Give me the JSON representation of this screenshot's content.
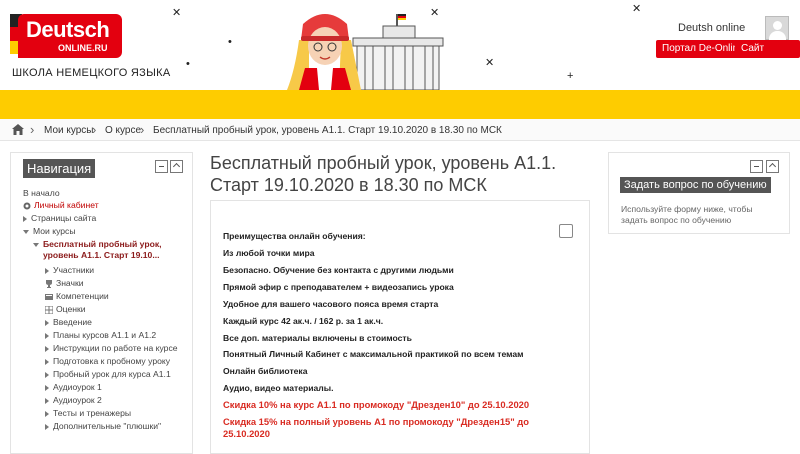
{
  "header": {
    "logo_main": "Deutsch",
    "logo_sub": "ONLINE.RU",
    "school": "ШКОЛА НЕМЕЦКОГО ЯЗЫКА",
    "user_name": "Deutsh online",
    "portal_button": "Портал De-Online",
    "site_button": "Сайт школы",
    "brand_red": "#e3000f",
    "band_yellow": "#fecc00"
  },
  "breadcrumb": {
    "items": [
      "Мои курсы",
      "О курсе",
      "Бесплатный пробный урок, уровень А1.1. Старт 19.10.2020 в 18.30 по МСК"
    ]
  },
  "navigation": {
    "title": "Навигация",
    "home": "В начало",
    "dashboard": "Личный кабинет",
    "site_pages": "Страницы сайта",
    "my_courses": "Мои курсы",
    "current_course": "Бесплатный пробный урок, уровень А1.1. Старт 19.10...",
    "items": [
      "Участники",
      "Значки",
      "Компетенции",
      "Оценки",
      "Введение",
      "Планы курсов А1.1 и А1.2",
      "Инструкции по работе на курсе",
      "Подготовка к пробному уроку",
      "Пробный урок для курса А1.1",
      "Аудиоурок 1",
      "Аудиоурок 2",
      "Тесты и тренажеры",
      "Дополнительные \"плюшки\""
    ]
  },
  "main": {
    "title": "Бесплатный пробный урок, уровень А1.1. Старт 19.10.2020 в 18.30 по МСК",
    "features": [
      "Преимущества онлайн обучения:",
      "Из любой точки мира",
      "Безопасно. Обучение без контакта с другими людьми",
      "Прямой эфир с преподавателем + видеозапись урока",
      "Удобное для вашего часового пояса время старта",
      "Каждый курс 42 ак.ч. / 162 р. за 1 ак.ч.",
      "Все доп. материалы включены в стоимость",
      "Понятный Личный Кабинет с максимальной практикой по всем темам",
      "Онлайн библиотека",
      "Аудио, видео материалы."
    ],
    "promos": [
      "Скидка 10% на курс А1.1 по промокоду \"Дрезден10\" до 25.10.2020",
      "Скидка 15% на полный уровень А1 по промокоду \"Дрезден15\" до 25.10.2020"
    ]
  },
  "right_block": {
    "title": "Задать вопрос по обучению",
    "text": "Используйте форму ниже, чтобы задать вопрос по обучению"
  }
}
